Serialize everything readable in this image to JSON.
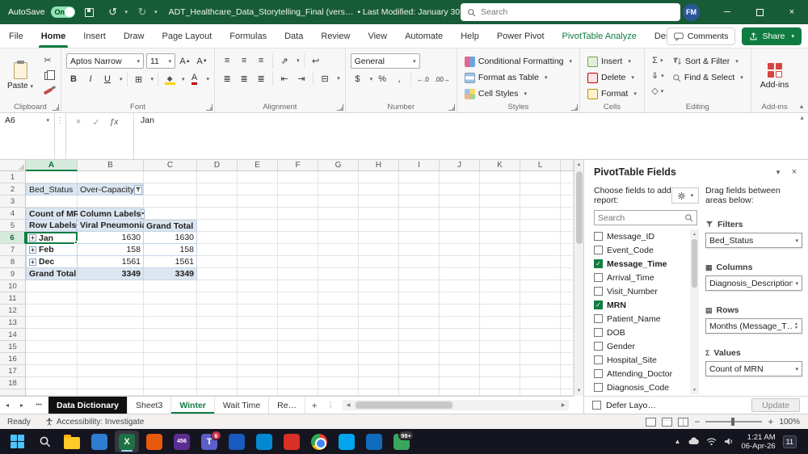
{
  "colors": {
    "excel_green": "#185C37",
    "accent_green": "#107C41",
    "pivot_blue": "#DCE6F1"
  },
  "titlebar": {
    "autosave_label": "AutoSave",
    "autosave_state": "On",
    "doc_title": "ADT_Healthcare_Data_Storytelling_Final (vers…",
    "modified": "• Last Modified: January 30",
    "search_placeholder": "Search",
    "avatar": "FM"
  },
  "menu_bar": {
    "tabs": [
      {
        "label": "File"
      },
      {
        "label": "Home",
        "active": true
      },
      {
        "label": "Insert"
      },
      {
        "label": "Draw"
      },
      {
        "label": "Page Layout"
      },
      {
        "label": "Formulas"
      },
      {
        "label": "Data"
      },
      {
        "label": "Review"
      },
      {
        "label": "View"
      },
      {
        "label": "Automate"
      },
      {
        "label": "Help"
      },
      {
        "label": "Power Pivot"
      },
      {
        "label": "PivotTable Analyze",
        "contextual": true
      },
      {
        "label": "Design"
      }
    ],
    "comments_label": "Comments",
    "share_label": "Share"
  },
  "ribbon": {
    "clipboard": {
      "paste_label": "Paste",
      "caption": "Clipboard"
    },
    "font": {
      "font_name": "Aptos Narrow",
      "font_size": "11",
      "caption": "Font"
    },
    "alignment": {
      "caption": "Alignment"
    },
    "number": {
      "format": "General",
      "caption": "Number"
    },
    "styles": {
      "conditional": "Conditional Formatting",
      "format_table": "Format as Table",
      "cell_styles": "Cell Styles",
      "caption": "Styles"
    },
    "cells": {
      "insert": "Insert",
      "delete": "Delete",
      "format": "Format",
      "caption": "Cells"
    },
    "editing": {
      "sort": "Sort & Filter",
      "find": "Find & Select",
      "caption": "Editing"
    },
    "addins": {
      "label": "Add-ins",
      "caption": "Add-ins"
    }
  },
  "formula_bar": {
    "name_box": "A6",
    "value": "Jan"
  },
  "grid": {
    "columns": [
      "A",
      "B",
      "C",
      "D",
      "E",
      "F",
      "G",
      "H",
      "I",
      "J",
      "K",
      "L"
    ],
    "rows": [
      "1",
      "2",
      "3",
      "4",
      "5",
      "6",
      "7",
      "8",
      "9",
      "10",
      "11",
      "12",
      "13",
      "14",
      "15",
      "16",
      "17",
      "18"
    ],
    "selected": {
      "col": "A",
      "row": "6"
    }
  },
  "pivot": {
    "filter": {
      "field": "Bed_Status",
      "value": "Over-Capacity"
    },
    "measure": "Count of MRN",
    "column_labels": "Column Labels",
    "row_labels": "Row Labels",
    "col1": "Viral Pneumonia",
    "grand_total_col": "Grand Total",
    "rows": [
      {
        "label": "Jan",
        "v": "1630",
        "t": "1630"
      },
      {
        "label": "Feb",
        "v": "158",
        "t": "158"
      },
      {
        "label": "Dec",
        "v": "1561",
        "t": "1561"
      }
    ],
    "totals": {
      "label": "Grand Total",
      "v": "3349",
      "t": "3349"
    }
  },
  "fields_pane": {
    "title": "PivotTable Fields",
    "choose_fields": "Choose fields to add to report:",
    "search_placeholder": "Search",
    "drag_fields": "Drag fields between areas below:",
    "fields": [
      {
        "name": "Message_ID",
        "checked": false
      },
      {
        "name": "Event_Code",
        "checked": false
      },
      {
        "name": "Message_Time",
        "checked": true
      },
      {
        "name": "Arrival_Time",
        "checked": false
      },
      {
        "name": "Visit_Number",
        "checked": false
      },
      {
        "name": "MRN",
        "checked": true
      },
      {
        "name": "Patient_Name",
        "checked": false
      },
      {
        "name": "DOB",
        "checked": false
      },
      {
        "name": "Gender",
        "checked": false
      },
      {
        "name": "Hospital_Site",
        "checked": false
      },
      {
        "name": "Attending_Doctor",
        "checked": false
      },
      {
        "name": "Diagnosis_Code",
        "checked": false
      }
    ],
    "areas": {
      "filters_label": "Filters",
      "filters_item": "Bed_Status",
      "columns_label": "Columns",
      "columns_item": "Diagnosis_Description",
      "rows_label": "Rows",
      "rows_item": "Months (Message_T…",
      "values_label": "Values",
      "values_item": "Count of MRN"
    },
    "defer_label": "Defer Layo…",
    "update_label": "Update"
  },
  "sheet_tabs": {
    "tabs": [
      {
        "name": "Data Dictionary",
        "black": true
      },
      {
        "name": "Sheet3"
      },
      {
        "name": "Winter",
        "active": true
      },
      {
        "name": "Wait Time"
      },
      {
        "name": "Re…"
      }
    ]
  },
  "status_bar": {
    "ready": "Ready",
    "accessibility": "Accessibility: Investigate",
    "zoom": "100%"
  },
  "taskbar": {
    "icons": [
      {
        "name": "start-button",
        "type": "start"
      },
      {
        "name": "search-button",
        "type": "search"
      },
      {
        "name": "file-explorer",
        "type": "folder"
      },
      {
        "name": "app-blue-tile",
        "color": "#2d7dd2"
      },
      {
        "name": "excel",
        "color": "#1e7145",
        "active": true,
        "glyph": "X"
      },
      {
        "name": "app-orange-tile",
        "color": "#e8590c"
      },
      {
        "name": "app-purple-tile",
        "color": "#5c2d91",
        "glyph": "456"
      },
      {
        "name": "teams",
        "color": "#5b5fc7",
        "glyph": "T",
        "badge": "6",
        "badge_color": "#c4314b"
      },
      {
        "name": "app-darkblue-tile",
        "color": "#185abd"
      },
      {
        "name": "app-lightblue-tile",
        "color": "#0288d1"
      },
      {
        "name": "acrobat",
        "color": "#d93025"
      },
      {
        "name": "chrome",
        "type": "chrome"
      },
      {
        "name": "app-teal-tile",
        "color": "#00a4ef"
      },
      {
        "name": "outlook",
        "color": "#0f6cbd"
      },
      {
        "name": "weather-widget",
        "color": "#3ba55d",
        "badge": "99+",
        "badge_color": "#3a3a3a"
      }
    ],
    "time": "1:21 AM",
    "date": "06-Apr-26",
    "notification_count": "11"
  }
}
